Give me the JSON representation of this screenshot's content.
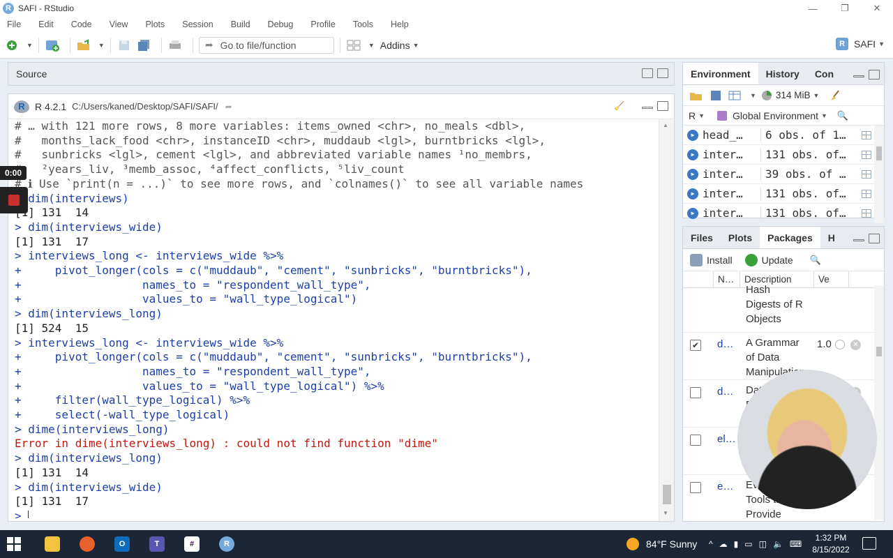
{
  "window": {
    "title": "SAFI - RStudio",
    "controls": [
      "—",
      "❐",
      "✕"
    ]
  },
  "menu": [
    "File",
    "Edit",
    "Code",
    "View",
    "Plots",
    "Session",
    "Build",
    "Debug",
    "Profile",
    "Tools",
    "Help"
  ],
  "toolbar": {
    "goto_placeholder": "Go to file/function",
    "addins_label": "Addins",
    "project_label": "SAFI",
    "icons": [
      "new-file-icon",
      "new-project-icon",
      "open-file-icon",
      "save-icon",
      "save-all-icon",
      "print-icon",
      "grid-layout-icon"
    ]
  },
  "source_pane": {
    "title": "Source"
  },
  "console": {
    "r_version": "R 4.2.1",
    "path": "C:/Users/kaned/Desktop/SAFI/SAFI/",
    "lines": [
      {
        "type": "comment",
        "text": "# … with 121 more rows, 8 more variables: items_owned <chr>, no_meals <dbl>,"
      },
      {
        "type": "comment",
        "text": "#   months_lack_food <chr>, instanceID <chr>, muddaub <lgl>, burntbricks <lgl>,"
      },
      {
        "type": "comment",
        "text": "#   sunbricks <lgl>, cement <lgl>, and abbreviated variable names ¹no_membrs,"
      },
      {
        "type": "comment",
        "text": "#   ²years_liv, ³memb_assoc, ⁴affect_conflicts, ⁵liv_count"
      },
      {
        "type": "comment",
        "text": "# ℹ Use `print(n = ...)` to see more rows, and `colnames()` to see all variable names"
      },
      {
        "type": "input",
        "text": "> dim(interviews)"
      },
      {
        "type": "output",
        "text": "[1] 131  14"
      },
      {
        "type": "input",
        "text": "> dim(interviews_wide)"
      },
      {
        "type": "output",
        "text": "[1] 131  17"
      },
      {
        "type": "input",
        "text": "> interviews_long <- interviews_wide %>%"
      },
      {
        "type": "input",
        "text": "+     pivot_longer(cols = c(\"muddaub\", \"cement\", \"sunbricks\", \"burntbricks\"),"
      },
      {
        "type": "input",
        "text": "+                  names_to = \"respondent_wall_type\","
      },
      {
        "type": "input",
        "text": "+                  values_to = \"wall_type_logical\")"
      },
      {
        "type": "input",
        "text": "> dim(interviews_long)"
      },
      {
        "type": "output",
        "text": "[1] 524  15"
      },
      {
        "type": "input",
        "text": "> interviews_long <- interviews_wide %>%"
      },
      {
        "type": "input",
        "text": "+     pivot_longer(cols = c(\"muddaub\", \"cement\", \"sunbricks\", \"burntbricks\"),"
      },
      {
        "type": "input",
        "text": "+                  names_to = \"respondent_wall_type\","
      },
      {
        "type": "input",
        "text": "+                  values_to = \"wall_type_logical\") %>%"
      },
      {
        "type": "input",
        "text": "+     filter(wall_type_logical) %>%"
      },
      {
        "type": "input",
        "text": "+     select(-wall_type_logical)"
      },
      {
        "type": "input",
        "text": "> dime(interviews_long)"
      },
      {
        "type": "error",
        "text": "Error in dime(interviews_long) : could not find function \"dime\""
      },
      {
        "type": "input",
        "text": "> dim(interviews_long)"
      },
      {
        "type": "output",
        "text": "[1] 131  14"
      },
      {
        "type": "input",
        "text": "> dim(interviews_wide)"
      },
      {
        "type": "output",
        "text": "[1] 131  17"
      },
      {
        "type": "prompt",
        "text": "> "
      }
    ]
  },
  "overlay": {
    "timer": "0:00"
  },
  "env_pane": {
    "tabs": [
      "Environment",
      "History",
      "Con"
    ],
    "memory": "314 MiB",
    "language": "R",
    "scope": "Global Environment",
    "rows": [
      {
        "name": "head_…",
        "value": "6 obs. of 1…"
      },
      {
        "name": "inter…",
        "value": "131 obs. of…"
      },
      {
        "name": "inter…",
        "value": "39 obs. of …"
      },
      {
        "name": "inter…",
        "value": "131 obs. of…"
      },
      {
        "name": "inter…",
        "value": "131 obs. of…"
      }
    ]
  },
  "files_pane": {
    "tabs": [
      "Files",
      "Plots",
      "Packages",
      "H"
    ],
    "install_label": "Install",
    "update_label": "Update",
    "columns": [
      "N…",
      "Description",
      "Ve"
    ],
    "rows": [
      {
        "checked": false,
        "show_check": false,
        "name": "",
        "desc": [
          "Hash",
          "Digests of R",
          "Objects"
        ],
        "version": ""
      },
      {
        "checked": true,
        "show_check": true,
        "name": "d…",
        "desc": [
          "A Grammar",
          "of Data",
          "Manipulation"
        ],
        "version": "1.0"
      },
      {
        "checked": false,
        "show_check": true,
        "name": "d…",
        "desc": [
          "Data T…",
          "B…"
        ],
        "version": ""
      },
      {
        "checked": false,
        "show_check": true,
        "name": "el…",
        "desc": [
          ""
        ],
        "version": ""
      },
      {
        "checked": false,
        "show_check": true,
        "name": "e…",
        "desc": [
          "Eva…",
          "Tools th…",
          "Provide"
        ],
        "version": ""
      }
    ]
  },
  "taskbar": {
    "apps": [
      "windows-start-icon",
      "file-explorer-icon",
      "firefox-icon",
      "outlook-icon",
      "teams-icon",
      "slack-icon",
      "rstudio-icon"
    ],
    "weather": "84°F  Sunny",
    "time": "1:32 PM",
    "date": "8/15/2022"
  },
  "colors": {
    "accent": "#75aadb",
    "console_input": "#1c3fa8",
    "console_error": "#c4170f"
  }
}
